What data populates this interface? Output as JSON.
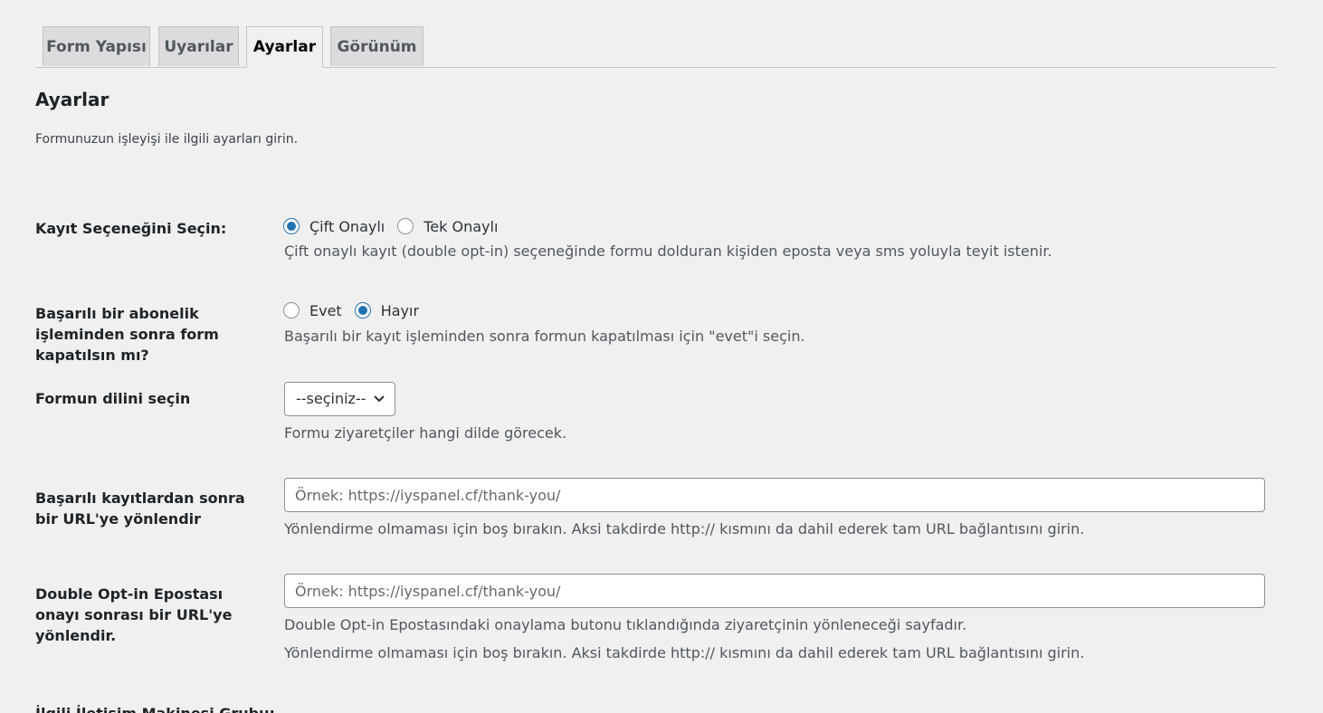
{
  "tabs": [
    {
      "label": "Form Yapısı",
      "active": false
    },
    {
      "label": "Uyarılar",
      "active": false
    },
    {
      "label": "Ayarlar",
      "active": true
    },
    {
      "label": "Görünüm",
      "active": false
    }
  ],
  "section": {
    "title": "Ayarlar",
    "description": "Formunuzun işleyişi ile ilgili ayarları girin."
  },
  "registration": {
    "label": "Kayıt Seçeneğini Seçin:",
    "options": [
      {
        "label": "Çift Onaylı",
        "checked": true
      },
      {
        "label": "Tek Onaylı",
        "checked": false
      }
    ],
    "description": "Çift onaylı kayıt (double opt-in) seçeneğinde formu dolduran kişiden eposta veya sms yoluyla teyit istenir."
  },
  "close_form": {
    "label": "Başarılı bir abonelik işleminden sonra form kapatılsın mı?",
    "options": [
      {
        "label": "Evet",
        "checked": false
      },
      {
        "label": "Hayır",
        "checked": true
      }
    ],
    "description": "Başarılı bir kayıt işleminden sonra formun kapatılması için \"evet\"i seçin."
  },
  "language": {
    "label": "Formun dilini seçin",
    "selected": "--seçiniz--",
    "description": "Formu ziyaretçiler hangi dilde görecek."
  },
  "redirect": {
    "label": "Başarılı kayıtlardan sonra bir URL'ye yönlendir",
    "placeholder": "Örnek: https://iyspanel.cf/thank-you/",
    "value": "",
    "description": "Yönlendirme olmaması için boş bırakın. Aksi takdirde http:// kısmını da dahil ederek tam URL bağlantısını girin."
  },
  "double_optin_redirect": {
    "label": "Double Opt-in Epostası onayı sonrası bir URL'ye yönlendir.",
    "placeholder": "Örnek: https://iyspanel.cf/thank-you/",
    "value": "",
    "description_1": "Double Opt-in Epostasındaki onaylama butonu tıklandığında ziyaretçinin yönleneceği sayfadır.",
    "description_2": "Yönlendirme olmaması için boş bırakın. Aksi takdirde http:// kısmını da dahil ederek tam URL bağlantısını girin."
  },
  "next_row": {
    "label": "İlgili İletişim Makinesi Grubu:"
  },
  "colors": {
    "accent": "#2271b1",
    "background": "#f0f0f1"
  }
}
